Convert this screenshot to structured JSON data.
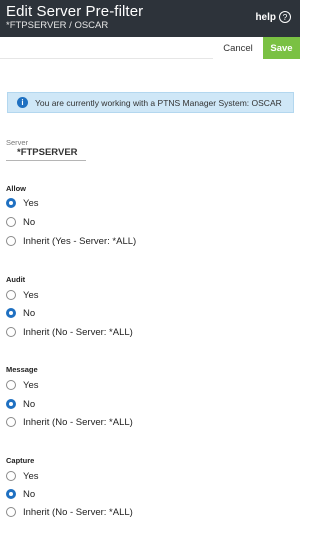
{
  "header": {
    "title": "Edit Server Pre-filter",
    "subtitle": "*FTPSERVER / OSCAR",
    "help_label": "help",
    "help_icon": "?"
  },
  "actions": {
    "cancel_label": "Cancel",
    "save_label": "Save",
    "save_color": "#7ac143"
  },
  "info": {
    "icon": "i",
    "text": "You are currently working with a PTNS Manager System: OSCAR",
    "background": "#cfe7f7",
    "icon_color": "#1f70c1"
  },
  "server": {
    "label": "Server",
    "value": "*FTPSERVER"
  },
  "groups": [
    {
      "label": "Allow",
      "options": [
        "Yes",
        "No",
        "Inherit (Yes - Server: *ALL)"
      ],
      "selected": "Yes"
    },
    {
      "label": "Audit",
      "options": [
        "Yes",
        "No",
        "Inherit (No - Server: *ALL)"
      ],
      "selected": "No"
    },
    {
      "label": "Message",
      "options": [
        "Yes",
        "No",
        "Inherit (No - Server: *ALL)"
      ],
      "selected": "No"
    },
    {
      "label": "Capture",
      "options": [
        "Yes",
        "No",
        "Inherit (No - Server: *ALL)"
      ],
      "selected": "No"
    }
  ]
}
